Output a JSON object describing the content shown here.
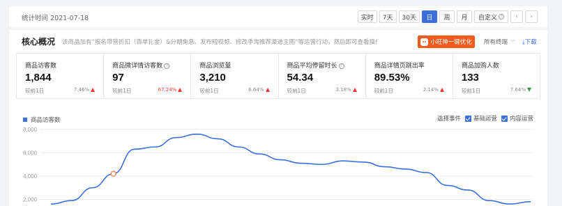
{
  "topbar": {
    "stat_time": "统计时间 2021-07-18",
    "ranges": [
      "实时",
      "7天",
      "30天",
      "日",
      "周",
      "月"
    ],
    "active_range": "日",
    "custom_label": "自定义",
    "prev_icon": "chevron-left-icon",
    "next_icon": "chevron-right-icon"
  },
  "core": {
    "title": "核心概况",
    "description": "该商品加有“报名带营折扣（百单扎金）&分期免息、发布短视频、修改手淘推荐渠道主图”等运营行动，然后即可查看操作记录并跟踪到...",
    "promo_label": "小旺神一键优化",
    "terminal_label": "所有终端",
    "download_label": "下载"
  },
  "metrics": [
    {
      "name": "商品访客数",
      "value": "1,844",
      "compare": "较前1日",
      "delta": "7.46%",
      "direction": "up",
      "help": false
    },
    {
      "name": "商品微详情访客数",
      "value": "97",
      "compare": "较前1日",
      "delta": "67.24%",
      "direction": "up",
      "help": true
    },
    {
      "name": "商品浏览量",
      "value": "3,210",
      "compare": "较前1日",
      "delta": "6.64%",
      "direction": "up",
      "help": false
    },
    {
      "name": "商品平均停留时长",
      "value": "54.34",
      "compare": "较前1日",
      "delta": "3.18%",
      "direction": "up",
      "help": true
    },
    {
      "name": "商品详情页跳出率",
      "value": "89.53%",
      "compare": "较前1日",
      "delta": "2.14%",
      "direction": "up",
      "help": false
    },
    {
      "name": "商品加购人数",
      "value": "133",
      "compare": "较前1日",
      "delta": "7.64%",
      "direction": "down",
      "help": false
    }
  ],
  "chart_options": {
    "select_events": "选择事件",
    "basic_ops": "基础运营",
    "content_ops": "内容运营"
  },
  "chart_data": {
    "type": "line",
    "series": [
      {
        "name": "商品访客数",
        "color": "#3c6fd8",
        "values": [
          1600,
          1900,
          3000,
          4200,
          6300,
          6500,
          7300,
          7600,
          7200,
          6500,
          5900,
          5400,
          5100,
          5000,
          5300,
          5200,
          4800,
          4600,
          4300,
          3200,
          2800,
          1900,
          1600,
          1800
        ]
      }
    ],
    "yticks": [
      "8,000",
      "6,000",
      "4,000",
      "2,000"
    ],
    "ylim": [
      0,
      8000
    ],
    "highlight_index": 3,
    "grid": true
  }
}
